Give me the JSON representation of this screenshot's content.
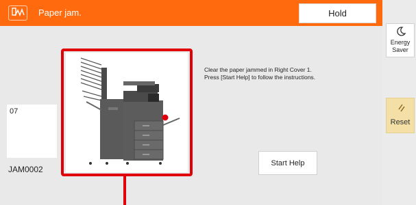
{
  "header": {
    "title": "Paper jam.",
    "icon": "paper-jam-icon",
    "hold_label": "Hold"
  },
  "counter": {
    "value": "07"
  },
  "jam_code": "JAM0002",
  "instructions": {
    "line1": "Clear the paper jammed in Right Cover 1.",
    "line2": "Press [Start Help] to follow the instructions."
  },
  "start_help_label": "Start Help",
  "side": {
    "energy_label": "Energy Saver",
    "energy_icon": "moon-icon",
    "reset_label": "Reset",
    "reset_icon": "reset-icon"
  },
  "colors": {
    "titlebar": "#ff6a0e",
    "highlight": "#e0000a",
    "reset_bg": "#f4dfa6"
  }
}
